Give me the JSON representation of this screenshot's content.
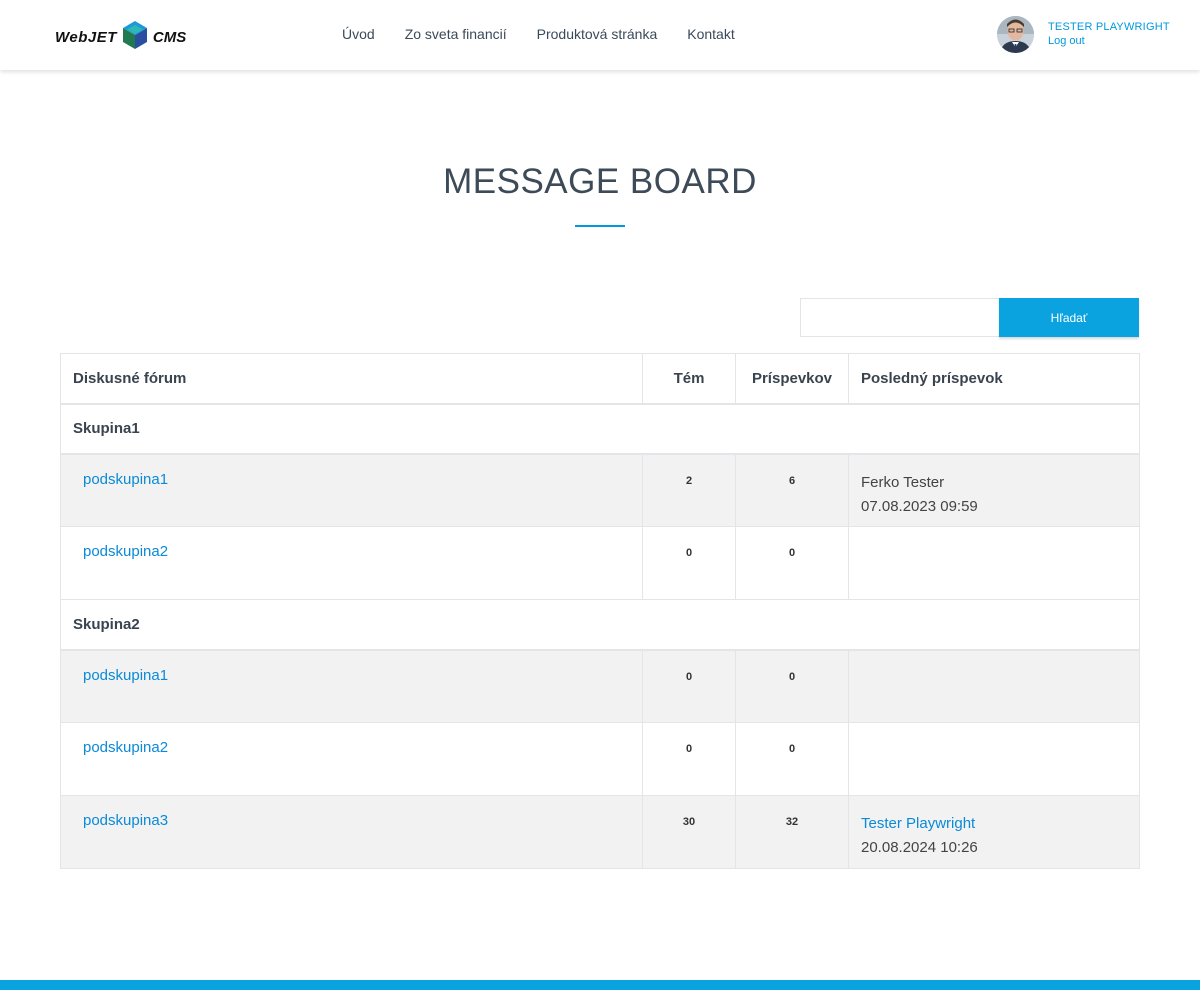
{
  "header": {
    "logo_webjet": "WebJET",
    "logo_cms": "CMS",
    "nav": [
      "Úvod",
      "Zo sveta financií",
      "Produktová stránka",
      "Kontakt"
    ],
    "user_name": "TESTER PLAYWRIGHT",
    "logout": "Log out"
  },
  "page_title": "MESSAGE BOARD",
  "search": {
    "placeholder": "",
    "button_label": "Hľadať"
  },
  "table": {
    "headers": {
      "forum": "Diskusné fórum",
      "topics": "Tém",
      "posts": "Príspevkov",
      "last": "Posledný príspevok"
    },
    "groups": [
      {
        "name": "Skupina1",
        "forums": [
          {
            "name": "podskupina1",
            "topics": "2",
            "posts": "6",
            "last_author": "Ferko Tester",
            "last_date": "07.08.2023 09:59"
          },
          {
            "name": "podskupina2",
            "topics": "0",
            "posts": "0",
            "last_author": "",
            "last_date": ""
          }
        ]
      },
      {
        "name": "Skupina2",
        "forums": [
          {
            "name": "podskupina1",
            "topics": "0",
            "posts": "0",
            "last_author": "",
            "last_date": ""
          },
          {
            "name": "podskupina2",
            "topics": "0",
            "posts": "0",
            "last_author": "",
            "last_date": ""
          },
          {
            "name": "podskupina3",
            "topics": "30",
            "posts": "32",
            "last_author": "Tester Playwright",
            "last_date": "20.08.2024 10:26"
          }
        ]
      }
    ]
  },
  "colors": {
    "accent": "#0aa3e0",
    "link": "#0a8ad8",
    "title": "#3d4a57"
  }
}
